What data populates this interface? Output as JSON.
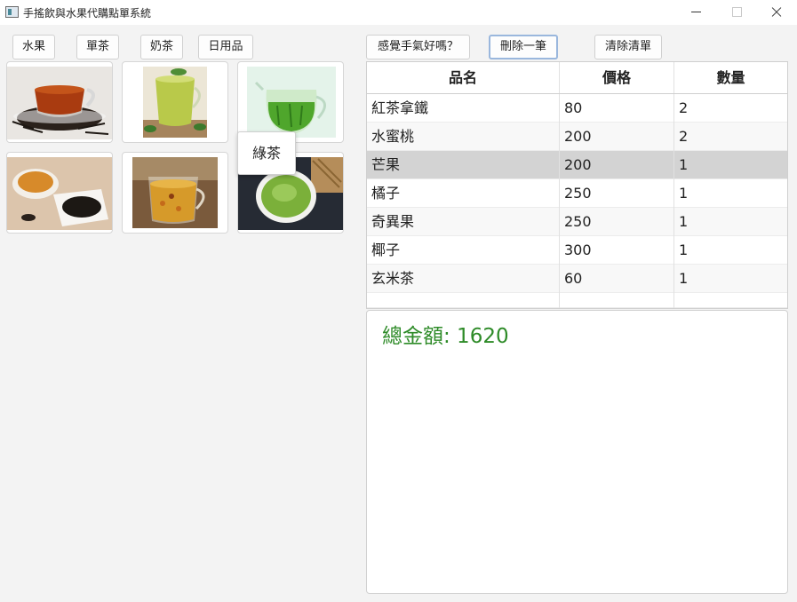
{
  "window": {
    "title": "手搖飲與水果代購點單系統"
  },
  "category_buttons": [
    "水果",
    "單茶",
    "奶茶",
    "日用品"
  ],
  "action_buttons": {
    "lucky": "感覺手氣好嗎？",
    "delete_one": "刪除一筆",
    "clear_list": "清除清單"
  },
  "products": [
    {
      "name": "black-tea-cup-photo"
    },
    {
      "name": "green-tea-glass-photo"
    },
    {
      "name": "green-tea-jug-photo"
    },
    {
      "name": "tea-cup-and-leaves-photo"
    },
    {
      "name": "herbal-tea-mug-photo"
    },
    {
      "name": "matcha-bowl-photo"
    }
  ],
  "tooltip": "綠茶",
  "table": {
    "headers": [
      "品名",
      "價格",
      "數量"
    ],
    "rows": [
      [
        "紅茶拿鐵",
        "80",
        "2"
      ],
      [
        "水蜜桃",
        "200",
        "2"
      ],
      [
        "芒果",
        "200",
        "1"
      ],
      [
        "橘子",
        "250",
        "1"
      ],
      [
        "奇異果",
        "250",
        "1"
      ],
      [
        "椰子",
        "300",
        "1"
      ],
      [
        "玄米茶",
        "60",
        "1"
      ]
    ],
    "selected_row_index": 2
  },
  "total": {
    "text": "總金額: 1620"
  },
  "colors": {
    "total_text": "#2e8b28",
    "selected_row": "#d3d3d3",
    "focus_border": "#9ab7dd"
  }
}
